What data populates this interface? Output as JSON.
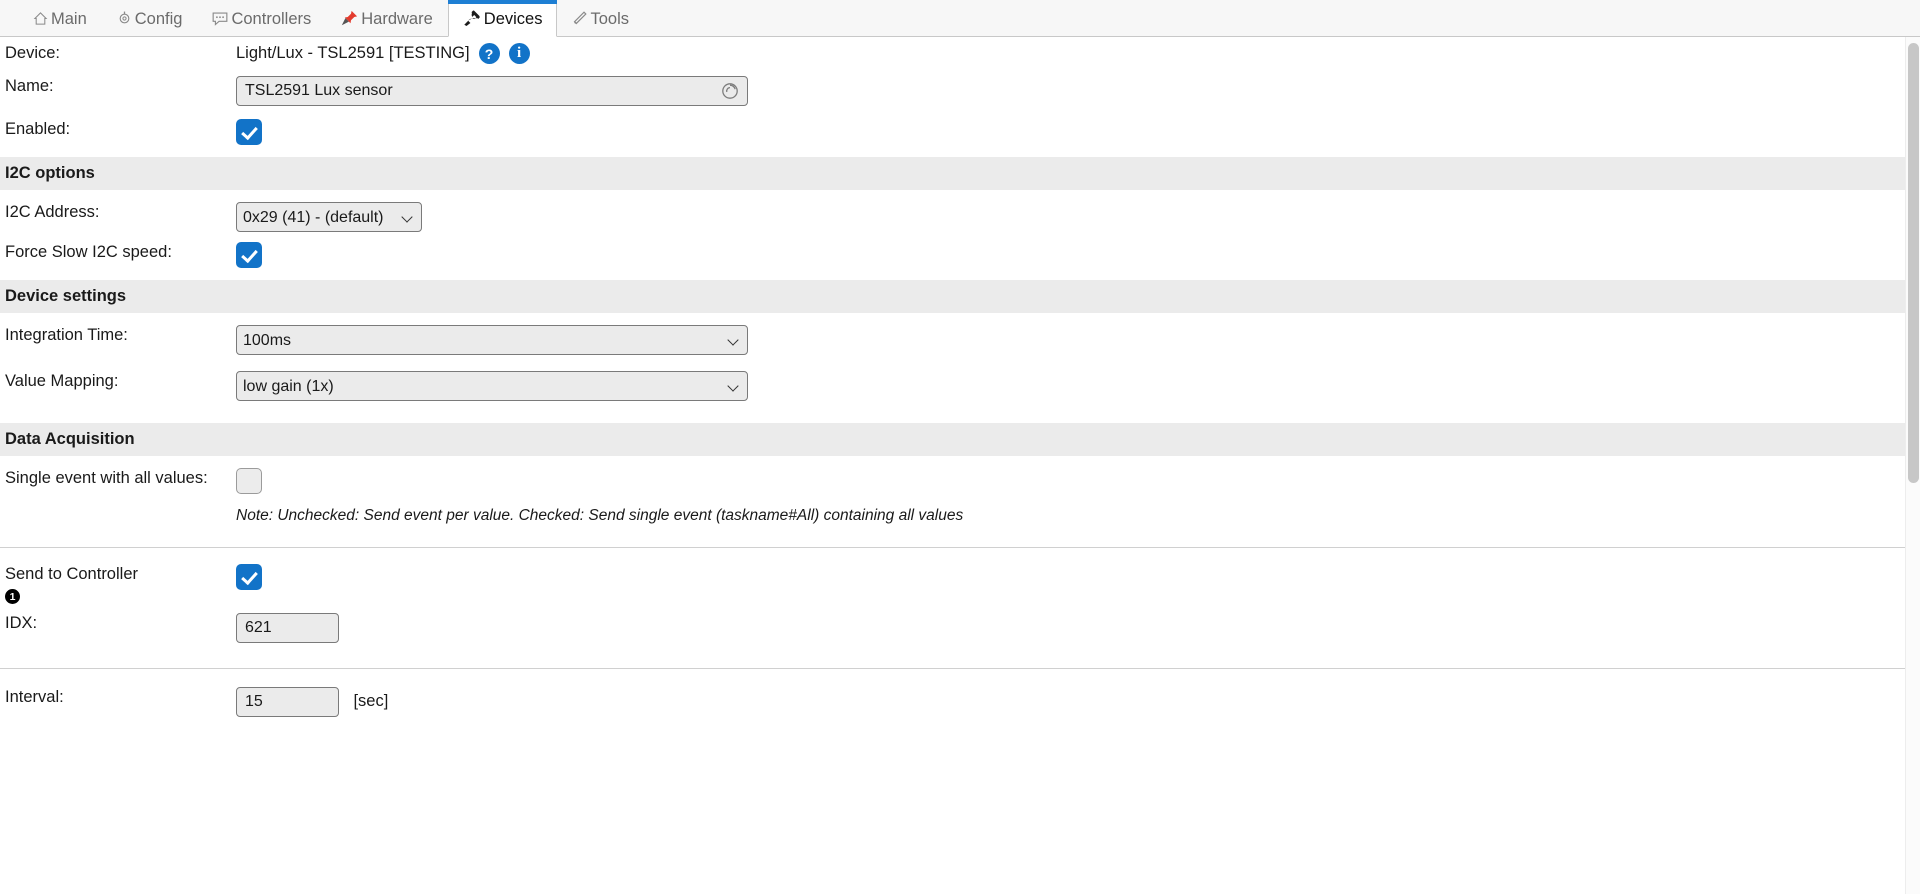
{
  "tabs": [
    {
      "label": "Main",
      "icon": "home-icon",
      "active": false
    },
    {
      "label": "Config",
      "icon": "gear-icon",
      "active": false
    },
    {
      "label": "Controllers",
      "icon": "chat-icon",
      "active": false
    },
    {
      "label": "Hardware",
      "icon": "pin-icon",
      "active": false
    },
    {
      "label": "Devices",
      "icon": "plug-icon",
      "active": true
    },
    {
      "label": "Tools",
      "icon": "wrench-icon",
      "active": false
    }
  ],
  "device": {
    "label": "Device:",
    "value": "Light/Lux - TSL2591 [TESTING]",
    "help_badge": "?",
    "info_badge": "i"
  },
  "name": {
    "label": "Name:",
    "value": "TSL2591 Lux sensor",
    "placeholder": ""
  },
  "enabled": {
    "label": "Enabled:",
    "checked": true
  },
  "i2c_section": {
    "title": "I2C options",
    "address": {
      "label": "I2C Address:",
      "value": "0x29 (41) - (default)",
      "options": [
        "0x29 (41) - (default)"
      ]
    },
    "force_slow": {
      "label": "Force Slow I2C speed:",
      "checked": true
    }
  },
  "device_settings": {
    "title": "Device settings",
    "integration_time": {
      "label": "Integration Time:",
      "value": "100ms",
      "options": [
        "100ms"
      ]
    },
    "value_mapping": {
      "label": "Value Mapping:",
      "value": "low gain (1x)",
      "options": [
        "low gain (1x)"
      ]
    }
  },
  "data_acquisition": {
    "title": "Data Acquisition",
    "single_event": {
      "label": "Single event with all values:",
      "checked": false,
      "note": "Note: Unchecked: Send event per value. Checked: Send single event (taskname#All) containing all values"
    },
    "send_to_controller": {
      "label": "Send to Controller",
      "badge": "1",
      "checked": true
    },
    "idx": {
      "label": "IDX:",
      "value": "621"
    }
  },
  "interval": {
    "label": "Interval:",
    "value": "15",
    "unit": "[sec]"
  },
  "colors": {
    "accent": "#1273c8",
    "tab_active_border": "#1e7fd4",
    "section_bg": "#ebebeb",
    "field_bg": "#ebebeb"
  }
}
